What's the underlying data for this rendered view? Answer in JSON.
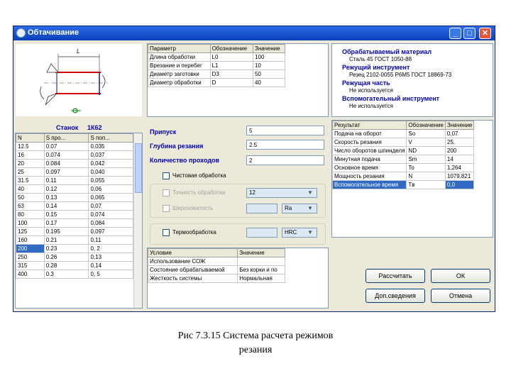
{
  "window": {
    "title": "Обтачивание",
    "minimize": "_",
    "maximize": "□",
    "close": "✕"
  },
  "sketch": {
    "length_label": "L"
  },
  "params_table": {
    "headers": [
      "Параметр",
      "Обозначение",
      "Значение"
    ],
    "rows": [
      [
        "Длина обработки",
        "L0",
        "100"
      ],
      [
        "Врезание и перебег",
        "L1",
        "10"
      ],
      [
        "Диаметр заготовки",
        "D3",
        "50"
      ],
      [
        "Диаметр обработки",
        "D",
        "40"
      ]
    ]
  },
  "info": {
    "material_label": "Обрабатываемый материал",
    "material_value": "Сталь 45 ГОСТ 1050-88",
    "tool_label": "Режущий инструмент",
    "tool_value": "Резец 2102-0055 Р6М5 ГОСТ 18869-73",
    "cutting_part_label": "Режущая часть",
    "cutting_part_value": "Не используется",
    "aux_tool_label": "Вспомогательный инструмент",
    "aux_tool_value": "Не используется"
  },
  "machine": {
    "label": "Станок",
    "value": "1К62",
    "headers": [
      "N",
      "S про...",
      "S поп..."
    ],
    "rows": [
      [
        "12.5",
        "0.07",
        "0,035"
      ],
      [
        "16",
        "0.074",
        "0,037"
      ],
      [
        "20",
        "0.084",
        "0,042"
      ],
      [
        "25",
        "0.097",
        "0,040"
      ],
      [
        "31.5",
        "0.11",
        "0,055"
      ],
      [
        "40",
        "0.12",
        "0,06"
      ],
      [
        "50",
        "0.13",
        "0,065"
      ],
      [
        "63",
        "0.14",
        "0,07"
      ],
      [
        "80",
        "0.15",
        "0,074"
      ],
      [
        "100",
        "0.17",
        "0,084"
      ],
      [
        "125",
        "0.195",
        "0,097"
      ],
      [
        "160",
        "0.21",
        "0,11"
      ],
      [
        "200",
        "0.23",
        "0, 2"
      ],
      [
        "250",
        "0.26",
        "0,13"
      ],
      [
        "315",
        "0.28",
        "0,14"
      ],
      [
        "400",
        "0.3",
        "0, 5"
      ]
    ],
    "selected_row": 12
  },
  "form": {
    "allowance_label": "Припуск",
    "allowance_value": "5",
    "depth_label": "Глубина резания",
    "depth_value": "2.5",
    "passes_label": "Количество проходов",
    "passes_value": "2",
    "finish_label": "Чистовая обработка",
    "accuracy_label": "Точность обработки",
    "accuracy_value": "12",
    "roughness_label": "Шероховатость",
    "roughness_unit": "Ra",
    "heat_label": "Термообработка",
    "heat_unit": "HRC"
  },
  "conditions_table": {
    "headers": [
      "Условие",
      "Значение"
    ],
    "rows": [
      [
        "Использование СОЖ",
        ""
      ],
      [
        "Состояние обрабатываемой",
        "Без корки и по"
      ],
      [
        "Жесткость системы",
        "Нормальная"
      ]
    ]
  },
  "results_table": {
    "headers": [
      "Результат",
      "Обозначение",
      "Значение"
    ],
    "rows": [
      [
        "Подача на оборот",
        "So",
        "0,07"
      ],
      [
        "Скорость резания",
        "V",
        "25,"
      ],
      [
        "Число оборотов шпинделя",
        "ND",
        "200"
      ],
      [
        "Минутная подача",
        "Sm",
        "14"
      ],
      [
        "Основное время",
        "To",
        "1,264"
      ],
      [
        "Мощность резания",
        "N",
        "1079,821"
      ],
      [
        "Вспомогательное время",
        "Tв",
        "0,0"
      ]
    ],
    "selected_row": 6
  },
  "buttons": {
    "calculate": "Рассчитать",
    "ok": "ОК",
    "extra_info": "Доп.сведения",
    "cancel": "Отмена"
  },
  "caption": {
    "line1": "Рис 7.3.15 Система расчета режимов",
    "line2": "резания"
  }
}
